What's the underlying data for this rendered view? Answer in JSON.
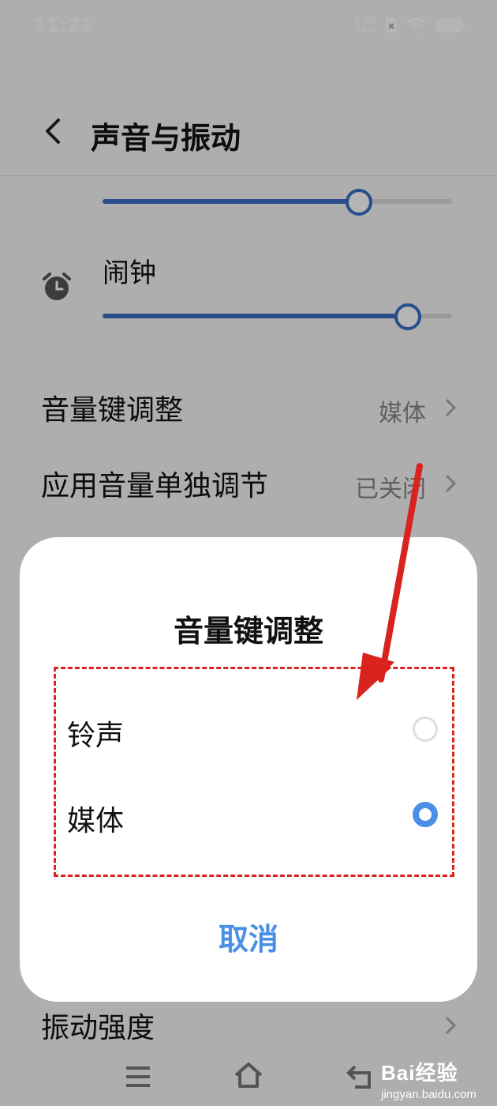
{
  "status_bar": {
    "time": "11:21",
    "net_speed": "2.30",
    "net_unit": "KB/s"
  },
  "header": {
    "title": "声音与振动"
  },
  "settings": {
    "top_slider_level": 0.73,
    "alarm": {
      "label": "闹钟",
      "level": 0.87
    },
    "rows": [
      {
        "label": "音量键调整",
        "value": "媒体"
      },
      {
        "label": "应用音量单独调节",
        "value": "已关闭"
      }
    ],
    "vibration_row": {
      "label": "振动强度"
    }
  },
  "dialog": {
    "title": "音量键调整",
    "options": [
      {
        "label": "铃声",
        "selected": false
      },
      {
        "label": "媒体",
        "selected": true
      }
    ],
    "cancel_label": "取消"
  },
  "watermark": {
    "brand": "Bai经验",
    "sub": "jingyan.baidu.com"
  },
  "colors": {
    "accent": "#4a8fe7",
    "slider": "#3a6fc4",
    "annotation": "#d9231e"
  }
}
